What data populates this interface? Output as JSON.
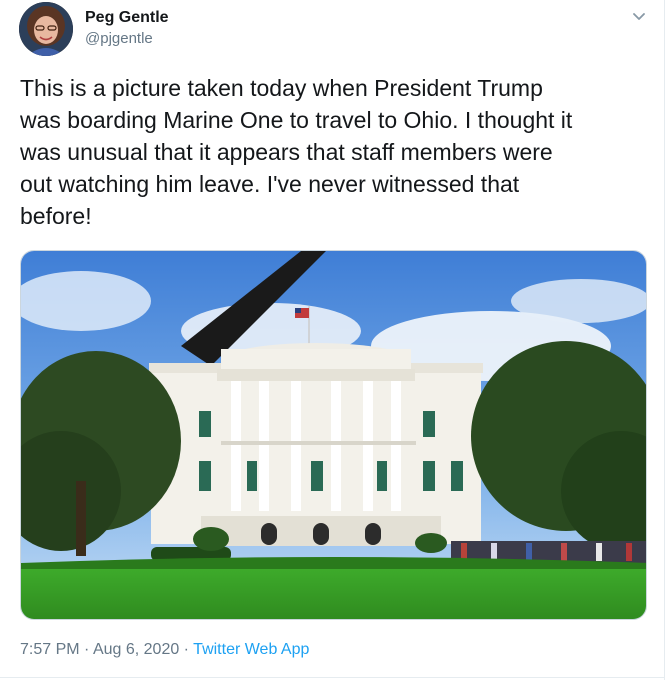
{
  "author": {
    "display_name": "Peg Gentle",
    "handle": "@pjgentle"
  },
  "tweet": {
    "text": "This is a picture taken today when President Trump\nwas boarding Marine One to travel to Ohio.  I thought it\nwas unusual that it appears that staff members were\nout watching him leave.  I've never witnessed that\nbefore!"
  },
  "footer": {
    "time": "7:57 PM",
    "sep1": " · ",
    "date": "Aug 6, 2020",
    "sep2": " · ",
    "app": "Twitter Web App"
  },
  "colors": {
    "link": "#1da1f2",
    "secondary": "#657786",
    "primary_text": "#14171a"
  },
  "icons": {
    "caret": "chevron-down-icon"
  }
}
